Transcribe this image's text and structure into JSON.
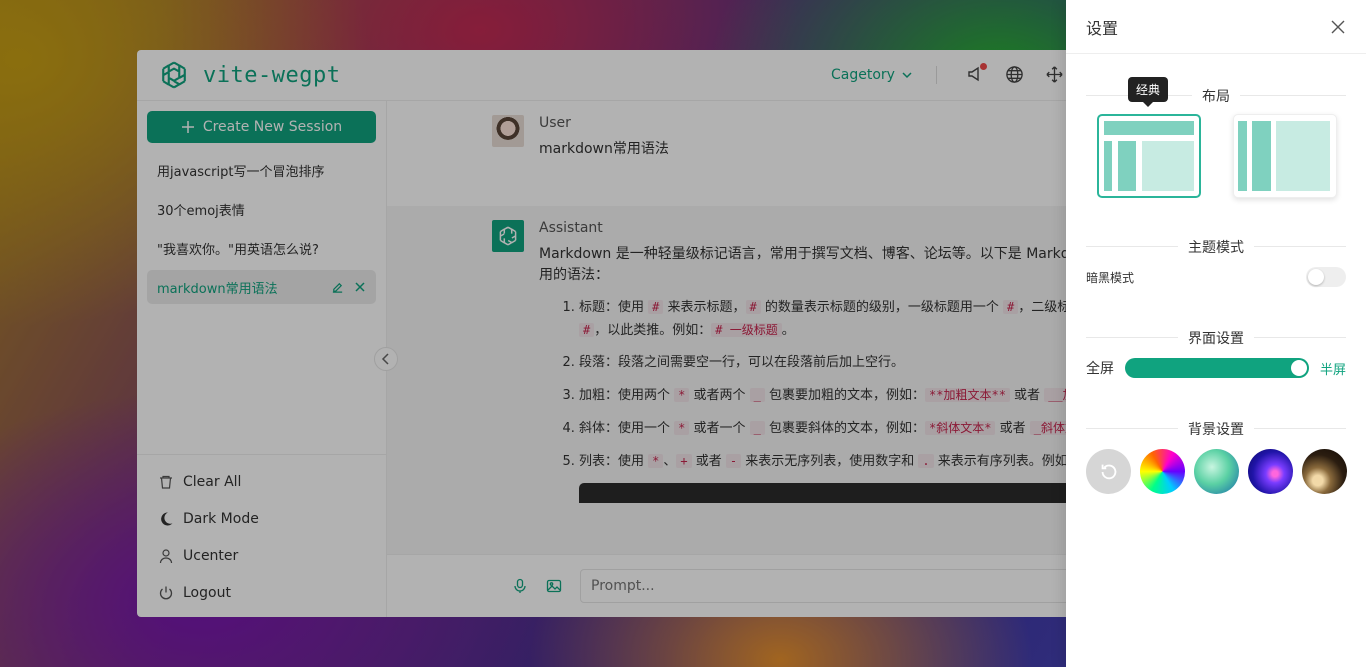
{
  "app": {
    "brand": "vite-wegpt"
  },
  "header": {
    "category": "Cagetory"
  },
  "sidebar": {
    "new_session": "Create New Session",
    "sessions": [
      {
        "title": "用javascript写一个冒泡排序"
      },
      {
        "title": "30个emoj表情"
      },
      {
        "title": "\"我喜欢你。\"用英语怎么说?"
      },
      {
        "title": "markdown常用语法",
        "active": true
      }
    ],
    "bottom": {
      "clear": "Clear All",
      "dark": "Dark Mode",
      "ucenter": "Ucenter",
      "logout": "Logout"
    }
  },
  "chat": {
    "user": {
      "role": "User",
      "text": "markdown常用语法"
    },
    "assistant": {
      "role": "Assistant",
      "intro": "Markdown 是一种轻量级标记语言，常用于撰写文档、博客、论坛等。以下是 Markdown 常用的语法：",
      "items": [
        {
          "a": "标题：使用 ",
          "c1": "#",
          "b": " 来表示标题，",
          "c2": "#",
          "d": " 的数量表示标题的级别，一级标题用一个 ",
          "c3": "#",
          "e": "，二级标题用两个 ",
          "c4": "#",
          "f": "，以此类推。例如：",
          "c5": "# 一级标题",
          "g": "。"
        },
        {
          "a": "段落：段落之间需要空一行，可以在段落前后加上空行。"
        },
        {
          "a": "加粗：使用两个 ",
          "c1": "*",
          "b": " 或者两个 ",
          "c2": "_",
          "d": " 包裹要加粗的文本，例如：",
          "c3": "**加粗文本**",
          "e": " 或者 ",
          "c4": "__加粗文本__",
          "f": "。"
        },
        {
          "a": "斜体：使用一个 ",
          "c1": "*",
          "b": " 或者一个 ",
          "c2": "_",
          "d": " 包裹要斜体的文本，例如：",
          "c3": "*斜体文本*",
          "e": " 或者 ",
          "c4": "_斜体文本_",
          "f": "。"
        },
        {
          "a": "列表：使用 ",
          "c1": "*",
          "b": "、",
          "c2": "+",
          "d": " 或者 ",
          "c3": "-",
          "e": " 来表示无序列表，使用数字和 ",
          "c4": ".",
          "f": " 来表示有序列表。例如："
        }
      ]
    }
  },
  "input": {
    "placeholder": "Prompt..."
  },
  "settings": {
    "title": "设置",
    "layout": {
      "label": "布局",
      "tooltip": "经典"
    },
    "theme": {
      "label": "主题模式",
      "dark_mode": "暗黑模式",
      "dark_enabled": false
    },
    "ui": {
      "label": "界面设置",
      "full": "全屏",
      "half": "半屏",
      "value": "半屏"
    },
    "background": {
      "label": "背景设置"
    }
  },
  "colors": {
    "accent": "#10a37f"
  }
}
